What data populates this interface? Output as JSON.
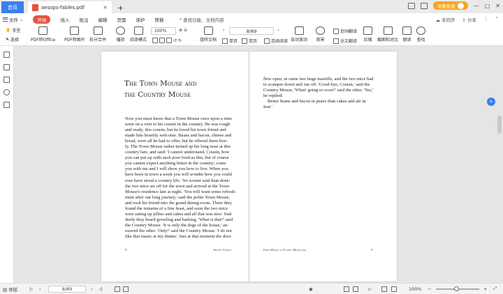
{
  "titlebar": {
    "home_tab": "首页",
    "doc_tab": "aesops-fables.pdf",
    "close_symbol": "×",
    "add_symbol": "+",
    "login_label": "访客登录",
    "colors": {
      "home_tab_bg": "#3c7ef0",
      "login_bg": "#f5a623",
      "pdf_icon": "#e8503f"
    }
  },
  "menubar": {
    "file": "文件",
    "items": [
      "开始",
      "插入",
      "批注",
      "编辑",
      "页面",
      "保护",
      "转换"
    ],
    "search": "查找功能、文档内容",
    "right": [
      "未同步",
      "分享"
    ]
  },
  "toolbar": {
    "hand": "手型",
    "select": "选择",
    "pdf_to_office": "PDF转Office",
    "pdf_to_image": "PDF转图片",
    "split_merge": "拆分合并",
    "play": "播放",
    "read_mode": "阅读模式",
    "zoom": "100%",
    "rotate": "旋转文档",
    "page": "8/89",
    "single": "单页",
    "double": "双页",
    "continuous": "连续阅读",
    "auto_scroll": "自动滚动",
    "background": "背景",
    "translate": "划词翻译",
    "full_translate": "全文翻译",
    "compress": "压缩",
    "screenshot_compare": "截图和对比",
    "read_aloud": "朗读",
    "find": "查找"
  },
  "page_left": {
    "title_lines": [
      "The Town Mouse and",
      "the Country Mouse"
    ],
    "body_lines": [
      "Now you must know that a Town Mouse once upon a time",
      "went on a visit to his cousin in the country. He was rough",
      "and ready, this cousin, but he loved his town friend and",
      "made him heartily welcome. Beans and bacon, cheese and",
      "bread, were all he had to offer, but he offered them free-",
      "ly. The Town Mouse rather turned up his long nose at this",
      "country fare, and said: 'I cannot understand, Cousin, how",
      "you can put up with such poor food as this, but of course",
      "you cannot expect anything better in the country; come",
      "you with me and I will show you how to live. When you",
      "have been in town a week you will wonder how you could",
      "ever have stood a country life.' No sooner said than done:",
      "the two mice set off for the town and arrived at the Town",
      "Mouse's residence late at night. 'You will want some refresh-",
      "ment after our long journey,' said the polite Town Mouse,",
      "and took his friend into the grand dining-room. There they",
      "found the remains of a fine feast, and soon the two mice",
      "were eating up jellies and cakes and all that was nice. Sud-",
      "denly they heard growling and barking. 'What is that?' said",
      "the Country Mouse. 'It is only the dogs of the house,' an-",
      "swered the other. 'Only!' said the Country Mouse. 'I do not",
      "like that music at my dinner.' Just at that moment the door"
    ],
    "footer_left": "8",
    "footer_right": "Aesop's Fables"
  },
  "page_right": {
    "body_lines": [
      "flew open, in came two huge mastiffs, and the two mice had",
      "to scamper down and run off. 'Good-bye, Cousin,' said the",
      "Country Mouse, 'What! going so soon?' said the other. 'Yes,'",
      "he replied;",
      "'Better beans and bacon in peace than cakes and ale in",
      "fear.'"
    ],
    "footer_left": "Free eBooks at Planet eBook.com",
    "footer_right": "9"
  },
  "statusbar": {
    "nav": "导航",
    "page": "8/89",
    "zoom": "100%",
    "zoom_level": 0.47
  }
}
